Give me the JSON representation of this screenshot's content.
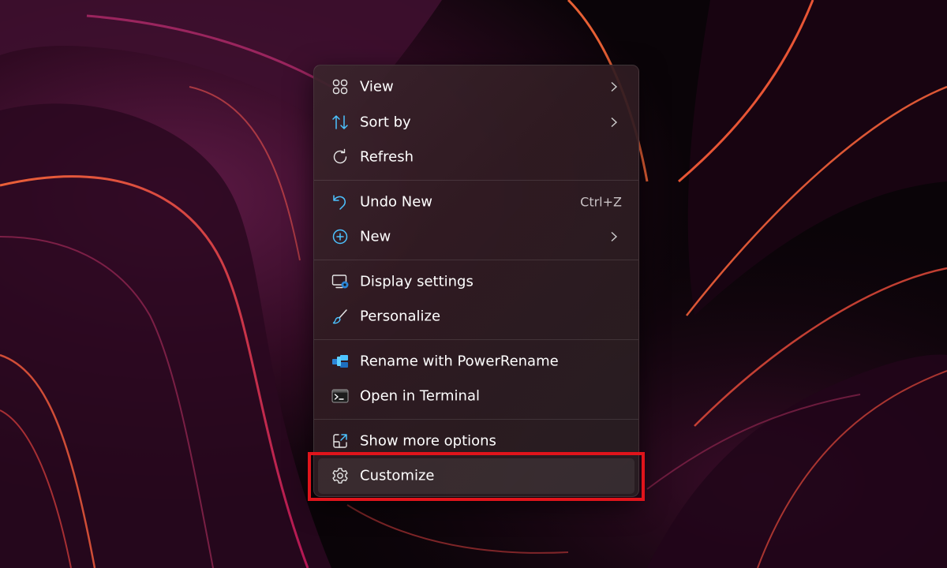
{
  "menu": {
    "groups": [
      [
        {
          "label": "View",
          "icon": "view-grid-icon",
          "submenu": true
        },
        {
          "label": "Sort by",
          "icon": "sort-arrows-icon",
          "submenu": true
        },
        {
          "label": "Refresh",
          "icon": "refresh-icon",
          "submenu": false
        }
      ],
      [
        {
          "label": "Undo New",
          "icon": "undo-icon",
          "shortcut": "Ctrl+Z"
        },
        {
          "label": "New",
          "icon": "add-circle-icon",
          "submenu": true
        }
      ],
      [
        {
          "label": "Display settings",
          "icon": "display-settings-icon"
        },
        {
          "label": "Personalize",
          "icon": "brush-icon"
        }
      ],
      [
        {
          "label": "Rename with PowerRename",
          "icon": "powerrename-icon"
        },
        {
          "label": "Open in Terminal",
          "icon": "terminal-icon"
        }
      ],
      [
        {
          "label": "Show more options",
          "icon": "open-external-icon"
        },
        {
          "label": "Customize",
          "icon": "gear-icon",
          "state": "highlighted"
        }
      ]
    ]
  },
  "colors": {
    "accent_blue": "#4cc2ff",
    "annotation_red": "#e0141b",
    "menu_text": "#ffffff",
    "shortcut_text": "#c9c2c5"
  }
}
